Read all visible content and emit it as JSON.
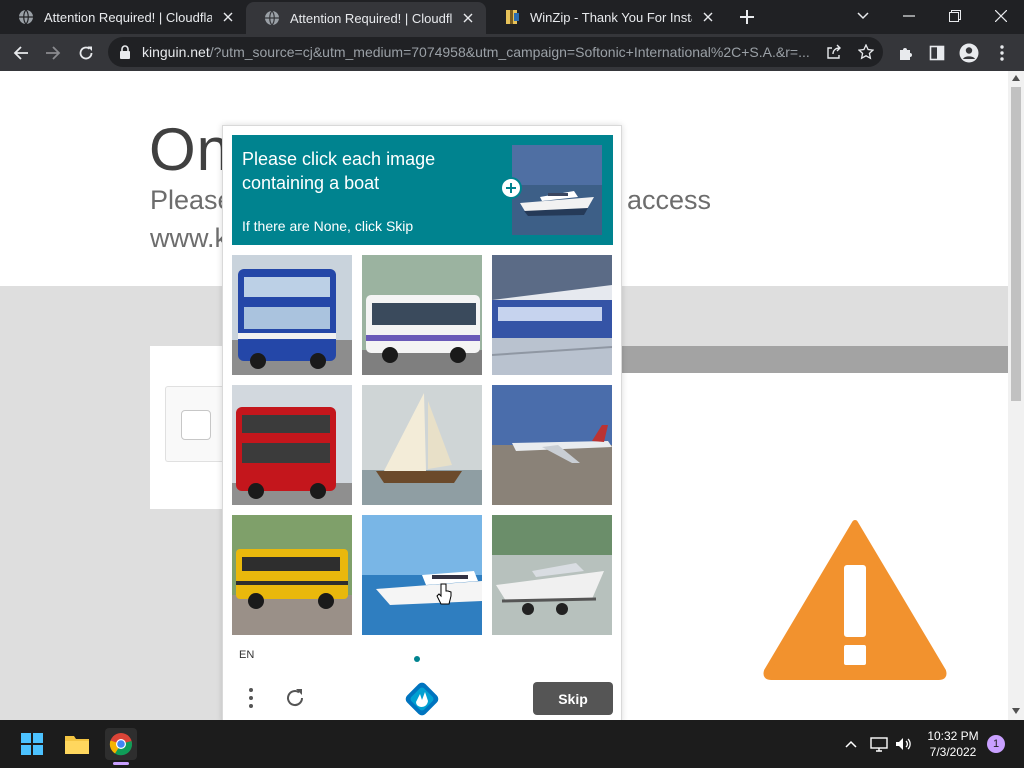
{
  "tabs": [
    {
      "title": "Attention Required! | Cloudflare",
      "favicon": "globe-icon",
      "active": false
    },
    {
      "title": "Attention Required! | Cloudflare",
      "favicon": "globe-icon",
      "active": true
    },
    {
      "title": "WinZip - Thank You For Installing",
      "favicon": "winzip-icon",
      "active": false
    }
  ],
  "toolbar": {
    "url_host": "kinguin.net",
    "url_rest": "/?utm_source=cj&utm_medium=7074958&utm_campaign=Softonic+International%2C+S.A.&r=..."
  },
  "page": {
    "heading": "On",
    "line1": "Please",
    "line1_end": "access",
    "line2": "www.k"
  },
  "captcha": {
    "prompt_text": "Please click each image containing a boat",
    "prompt_hint": "If there are None, click Skip",
    "images": [
      {
        "label": "double-decker-bus-blue"
      },
      {
        "label": "city-bus-white"
      },
      {
        "label": "train-at-station"
      },
      {
        "label": "double-decker-bus-red"
      },
      {
        "label": "sailboat"
      },
      {
        "label": "airplane-on-runway"
      },
      {
        "label": "school-bus-yellow"
      },
      {
        "label": "motor-yacht"
      },
      {
        "label": "speedboat-on-trailer"
      }
    ],
    "language": "EN",
    "skip_label": "Skip"
  },
  "taskbar": {
    "time": "10:32 PM",
    "date": "7/3/2022",
    "notifications": "1"
  },
  "colors": {
    "captcha_teal": "#00838f",
    "warning_orange": "#f2922e",
    "skip_gray": "#555555"
  }
}
